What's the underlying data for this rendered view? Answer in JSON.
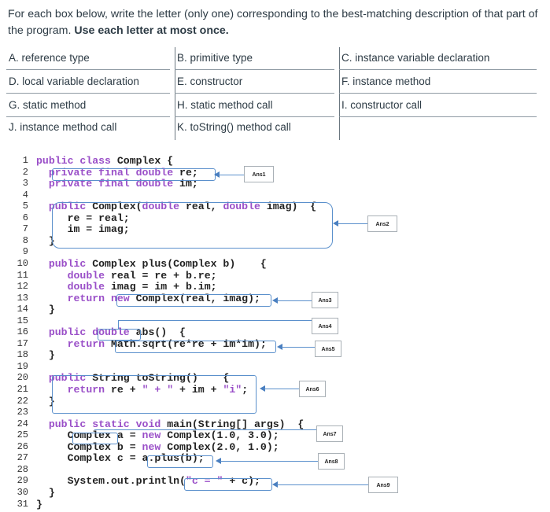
{
  "instructions": {
    "text_plain": "For each box below, write the letter (only one) corresponding to the best-matching description of that part of the program.",
    "text_bold": "Use each letter at most once."
  },
  "legend": [
    [
      "A. reference type",
      "B. primitive type",
      "C. instance variable declaration"
    ],
    [
      "D. local variable declaration",
      "E. constructor",
      "F. instance method"
    ],
    [
      "G. static method",
      "H. static method call",
      "I. constructor call"
    ],
    [
      "J. instance method call",
      "K. toString() method call",
      ""
    ]
  ],
  "code_lines": [
    {
      "n": "1",
      "segs": [
        [
          "kw",
          "public class "
        ],
        [
          "",
          "Complex {"
        ]
      ]
    },
    {
      "n": "2",
      "segs": [
        [
          "",
          "  "
        ],
        [
          "kw",
          "private final double "
        ],
        [
          "",
          "re;"
        ]
      ]
    },
    {
      "n": "3",
      "segs": [
        [
          "",
          "  "
        ],
        [
          "kw",
          "private final double "
        ],
        [
          "",
          "im;"
        ]
      ]
    },
    {
      "n": "4",
      "segs": []
    },
    {
      "n": "5",
      "segs": [
        [
          "",
          "  "
        ],
        [
          "kw",
          "public "
        ],
        [
          "",
          "Complex("
        ],
        [
          "kw",
          "double "
        ],
        [
          "",
          "real, "
        ],
        [
          "kw",
          "double "
        ],
        [
          "",
          "imag)  {"
        ]
      ]
    },
    {
      "n": "6",
      "segs": [
        [
          "",
          "     re = real;"
        ]
      ]
    },
    {
      "n": "7",
      "segs": [
        [
          "",
          "     im = imag;"
        ]
      ]
    },
    {
      "n": "8",
      "segs": [
        [
          "",
          "  }"
        ]
      ]
    },
    {
      "n": "9",
      "segs": []
    },
    {
      "n": "10",
      "segs": [
        [
          "",
          "  "
        ],
        [
          "kw",
          "public "
        ],
        [
          "",
          "Complex plus(Complex b)    {"
        ]
      ]
    },
    {
      "n": "11",
      "segs": [
        [
          "",
          "     "
        ],
        [
          "kw",
          "double "
        ],
        [
          "",
          "real = re + b.re;"
        ]
      ]
    },
    {
      "n": "12",
      "segs": [
        [
          "",
          "     "
        ],
        [
          "kw",
          "double "
        ],
        [
          "",
          "imag = im + b.im;"
        ]
      ]
    },
    {
      "n": "13",
      "segs": [
        [
          "",
          "     "
        ],
        [
          "kw",
          "return "
        ],
        [
          "kw",
          "new "
        ],
        [
          "",
          "Complex(real, imag);"
        ]
      ]
    },
    {
      "n": "14",
      "segs": [
        [
          "",
          "  }"
        ]
      ]
    },
    {
      "n": "15",
      "segs": []
    },
    {
      "n": "16",
      "segs": [
        [
          "",
          "  "
        ],
        [
          "kw",
          "public "
        ],
        [
          "kw",
          "double"
        ],
        [
          "",
          " abs()  {"
        ]
      ]
    },
    {
      "n": "17",
      "segs": [
        [
          "",
          "     "
        ],
        [
          "kw",
          "return "
        ],
        [
          "",
          "Math.sqrt(re*re + im*im);"
        ]
      ]
    },
    {
      "n": "18",
      "segs": [
        [
          "",
          "  }"
        ]
      ]
    },
    {
      "n": "19",
      "segs": []
    },
    {
      "n": "20",
      "segs": [
        [
          "",
          "  "
        ],
        [
          "kw",
          "public "
        ],
        [
          "",
          "String toString()    {"
        ]
      ]
    },
    {
      "n": "21",
      "segs": [
        [
          "",
          "     "
        ],
        [
          "kw",
          "return "
        ],
        [
          "",
          "re + "
        ],
        [
          "str",
          "\" + \""
        ],
        [
          "",
          " + im + "
        ],
        [
          "str",
          "\"i\""
        ],
        [
          "",
          ";"
        ]
      ]
    },
    {
      "n": "22",
      "segs": [
        [
          "",
          "  }"
        ]
      ]
    },
    {
      "n": "23",
      "segs": []
    },
    {
      "n": "24",
      "segs": [
        [
          "",
          "  "
        ],
        [
          "kw",
          "public static void "
        ],
        [
          "",
          "main(String[] args)  {"
        ]
      ]
    },
    {
      "n": "25",
      "segs": [
        [
          "",
          "     Complex a = "
        ],
        [
          "kw",
          "new "
        ],
        [
          "",
          "Complex(1.0, 3.0);"
        ]
      ]
    },
    {
      "n": "26",
      "segs": [
        [
          "",
          "     Complex b = "
        ],
        [
          "kw",
          "new "
        ],
        [
          "",
          "Complex(2.0, 1.0);"
        ]
      ]
    },
    {
      "n": "27",
      "segs": [
        [
          "",
          "     Complex c = a.plus(b);"
        ]
      ]
    },
    {
      "n": "28",
      "segs": []
    },
    {
      "n": "29",
      "segs": [
        [
          "",
          "     System.out.println("
        ],
        [
          "str",
          "\"c = \""
        ],
        [
          "",
          " + c);"
        ]
      ]
    },
    {
      "n": "30",
      "segs": [
        [
          "",
          "  }"
        ]
      ]
    },
    {
      "n": "31",
      "segs": [
        [
          "",
          "}"
        ]
      ]
    }
  ],
  "answers": [
    "Ans1",
    "Ans2",
    "Ans3",
    "Ans4",
    "Ans5",
    "Ans6",
    "Ans7",
    "Ans8",
    "Ans9"
  ],
  "colors": {
    "highlight": "#5b90cc",
    "keyword": "#9a4fc8",
    "text": "#2d3b45"
  }
}
